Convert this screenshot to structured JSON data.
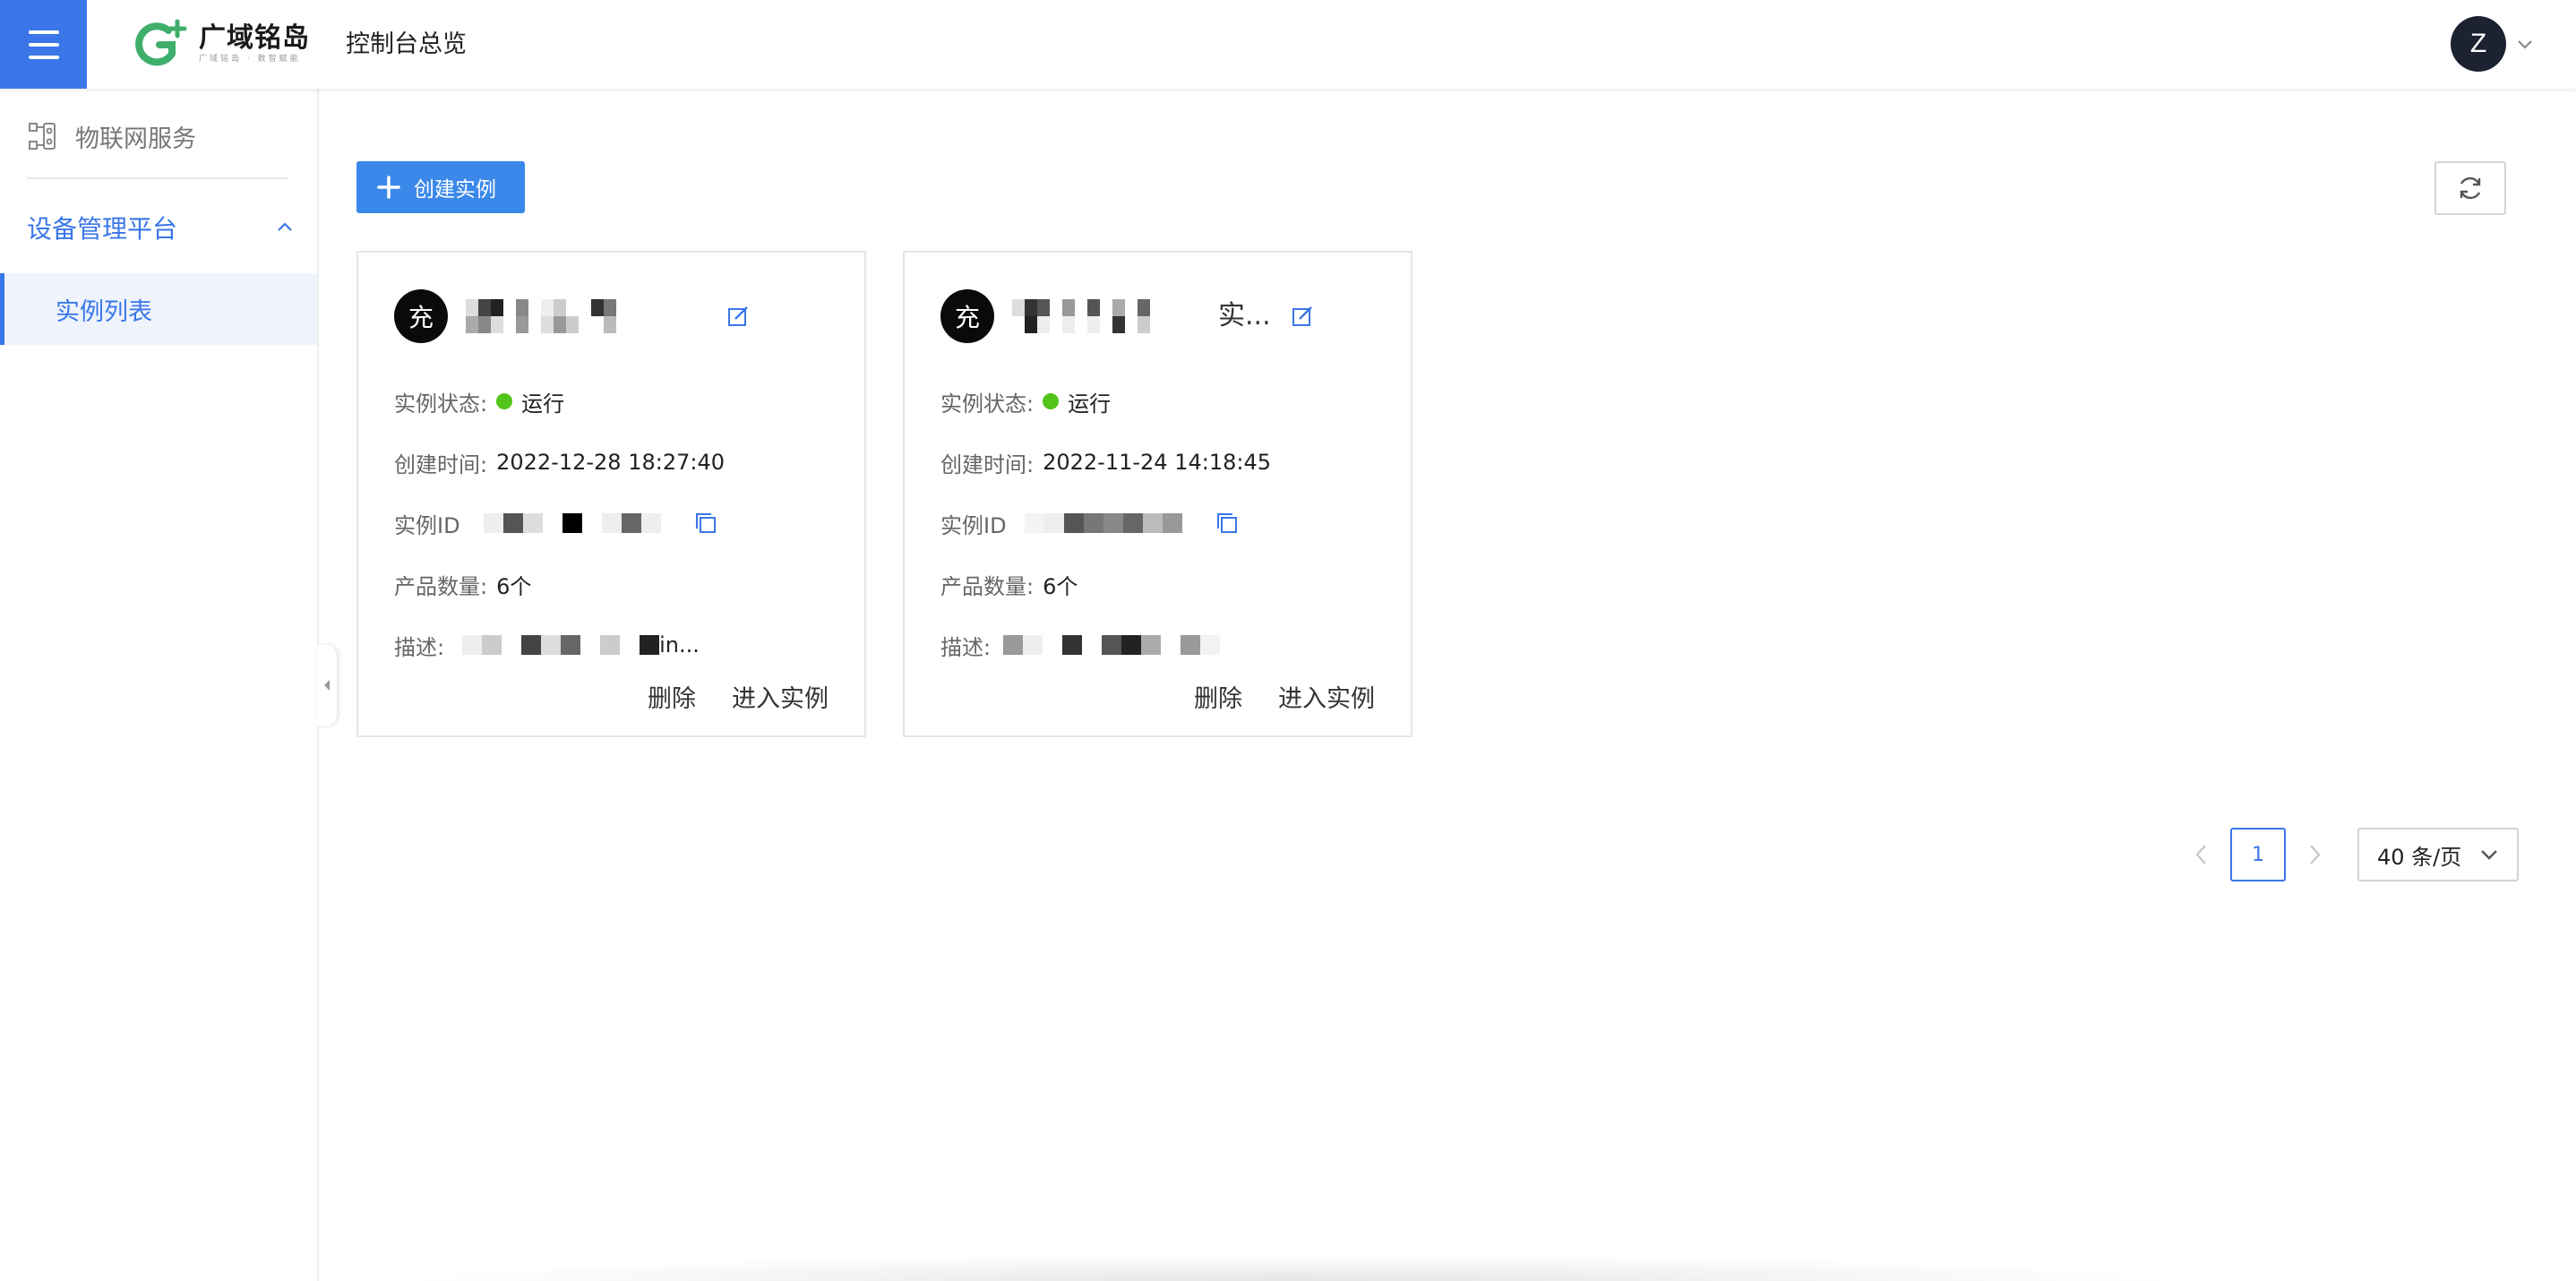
{
  "header": {
    "menu_icon": "hamburger-menu-icon",
    "logo_title": "广域铭岛",
    "logo_subtitle": "广域铭岛 · 数智赋能",
    "page_title": "控制台总览",
    "user_initial": "Z"
  },
  "sidebar": {
    "group_label": "物联网服务",
    "platform_label": "设备管理平台",
    "items": [
      {
        "label": "实例列表",
        "active": true
      }
    ]
  },
  "toolbar": {
    "create_label": "创建实例",
    "refresh_icon": "refresh-icon"
  },
  "cards": [
    {
      "avatar": "充",
      "name_tail": "",
      "status_label": "实例状态:",
      "status_value": "运行",
      "created_label": "创建时间:",
      "created_value": "2022-12-28 18:27:40",
      "id_label": "实例ID",
      "products_label": "产品数量:",
      "products_value": "6个",
      "desc_label": "描述:",
      "desc_tail": "in...",
      "delete_label": "删除",
      "enter_label": "进入实例"
    },
    {
      "avatar": "充",
      "name_tail": "实...",
      "status_label": "实例状态:",
      "status_value": "运行",
      "created_label": "创建时间:",
      "created_value": "2022-11-24 14:18:45",
      "id_label": "实例ID",
      "products_label": "产品数量:",
      "products_value": "6个",
      "desc_label": "描述:",
      "desc_tail": "",
      "delete_label": "删除",
      "enter_label": "进入实例"
    }
  ],
  "pagination": {
    "current_page": "1",
    "page_size": "40 条/页"
  },
  "colors": {
    "primary": "#3a76e8",
    "button": "#3a88ea",
    "running": "#52c41a",
    "avatar_dark": "#1c2232"
  }
}
